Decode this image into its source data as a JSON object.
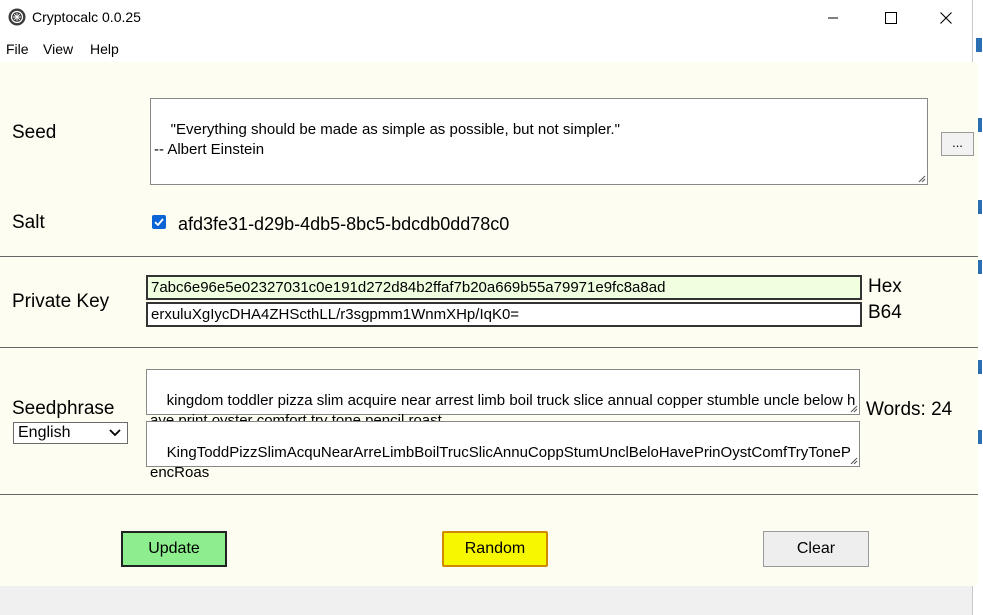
{
  "window": {
    "title": "Cryptocalc 0.0.25"
  },
  "menu": {
    "items": [
      "File",
      "View",
      "Help"
    ]
  },
  "seed": {
    "label": "Seed",
    "text": "\"Everything should be made as simple as possible, but not simpler.\"\n-- Albert Einstein",
    "browse_label": "..."
  },
  "salt": {
    "label": "Salt",
    "checked": true,
    "value": "afd3fe31-d29b-4db5-8bc5-bdcdb0dd78c0"
  },
  "private_key": {
    "label": "Private Key",
    "hex_value": "7abc6e96e5e02327031c0e191d272d84b2ffaf7b20a669b55a79971e9fc8a8ad",
    "hex_label": "Hex",
    "b64_value": "erxuluXgIycDHA4ZHScthLL/r3sgpmm1WnmXHp/IqK0=",
    "b64_label": "B64"
  },
  "seedphrase": {
    "label": "Seedphrase",
    "language": "English",
    "words": "kingdom toddler pizza slim acquire near arrest limb boil truck slice annual copper stumble uncle below have print oyster comfort try tone pencil roast",
    "abbreviated": "KingToddPizzSlimAcquNearArreLimbBoilTrucSlicAnnuCoppStumUnclBeloHavePrinOystComfTryTonePencRoas",
    "word_count_label": "Words: 24"
  },
  "buttons": {
    "update": "Update",
    "random": "Random",
    "clear": "Clear"
  },
  "colors": {
    "background": "#fdfdf1",
    "hex_field_bg": "#efffe0",
    "update_bg": "#8cee8c",
    "random_bg": "#f7f700",
    "clear_bg": "#eeeeee"
  }
}
